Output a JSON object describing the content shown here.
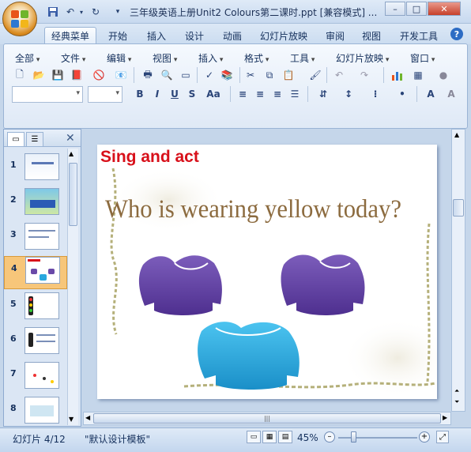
{
  "window": {
    "title": "三年级英语上册Unit2 Colours第二课时.ppt [兼容模式] ...",
    "controls": {
      "minimize": "–",
      "maximize": "□",
      "close": "✕"
    }
  },
  "quick_access": {
    "save_icon": "save-icon",
    "undo_icon": "undo-icon",
    "redo_icon": "redo-icon"
  },
  "tabs": [
    {
      "label": "经典菜单",
      "active": true
    },
    {
      "label": "开始"
    },
    {
      "label": "插入"
    },
    {
      "label": "设计"
    },
    {
      "label": "动画"
    },
    {
      "label": "幻灯片放映"
    },
    {
      "label": "审阅"
    },
    {
      "label": "视图"
    },
    {
      "label": "开发工具"
    }
  ],
  "menu": [
    "全部",
    "文件",
    "编辑",
    "视图",
    "插入",
    "格式",
    "工具",
    "幻灯片放映",
    "窗口"
  ],
  "format_buttons": {
    "bold": "B",
    "italic": "I",
    "underline": "U",
    "strike": "S",
    "case": "Aa"
  },
  "slides_panel": {
    "thumbnails": [
      {
        "num": "1"
      },
      {
        "num": "2"
      },
      {
        "num": "3"
      },
      {
        "num": "4",
        "selected": true
      },
      {
        "num": "5"
      },
      {
        "num": "6"
      },
      {
        "num": "7"
      },
      {
        "num": "8"
      }
    ]
  },
  "slide": {
    "heading": "Sing and act",
    "question": "Who is wearing yellow today?"
  },
  "colors": {
    "heading": "#d8101a",
    "question": "#8c6b3f",
    "shirt_purple": "#6a4aa8",
    "shirt_blue": "#2aa8de",
    "accent_orange": "#f7c67a"
  },
  "status": {
    "slide_info": "幻灯片 4/12",
    "theme": "\"默认设计模板\"",
    "zoom": "45%"
  }
}
